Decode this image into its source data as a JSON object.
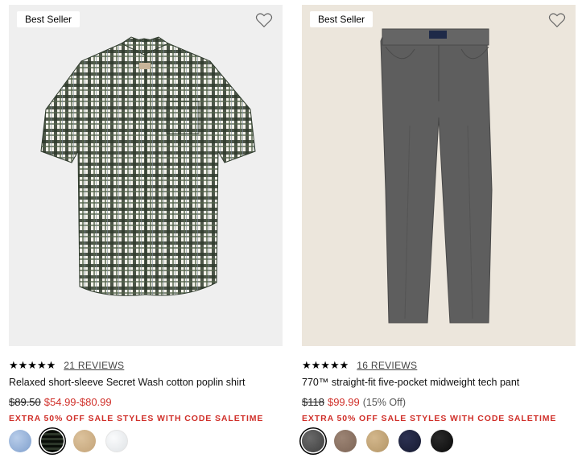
{
  "products": [
    {
      "badge": "Best Seller",
      "stars": "★★★★★",
      "reviews": "21 REVIEWS",
      "name": "Relaxed short-sleeve Secret Wash cotton poplin shirt",
      "original_price": "$89.50",
      "sale_price": "$54.99-$80.99",
      "discount": "",
      "promo": "EXTRA 50% OFF SALE STYLES WITH CODE SALETIME",
      "swatches": [
        "#8fb0d8",
        "#3f4a3c",
        "#c9a97f",
        "#e8ecef"
      ],
      "selected_swatch": 1
    },
    {
      "badge": "Best Seller",
      "stars": "★★★★★",
      "reviews": "16 REVIEWS",
      "name": "770™ straight-fit five-pocket midweight tech pant",
      "original_price": "$118",
      "sale_price": "$99.99",
      "discount": "(15% Off)",
      "promo": "EXTRA 50% OFF SALE STYLES WITH CODE SALETIME",
      "swatches": [
        "#4a4a4a",
        "#8a7262",
        "#c2a57a",
        "#1c2038",
        "#111111"
      ],
      "selected_swatch": 0
    }
  ],
  "icons": {
    "wishlist": "heart-outline-icon"
  }
}
